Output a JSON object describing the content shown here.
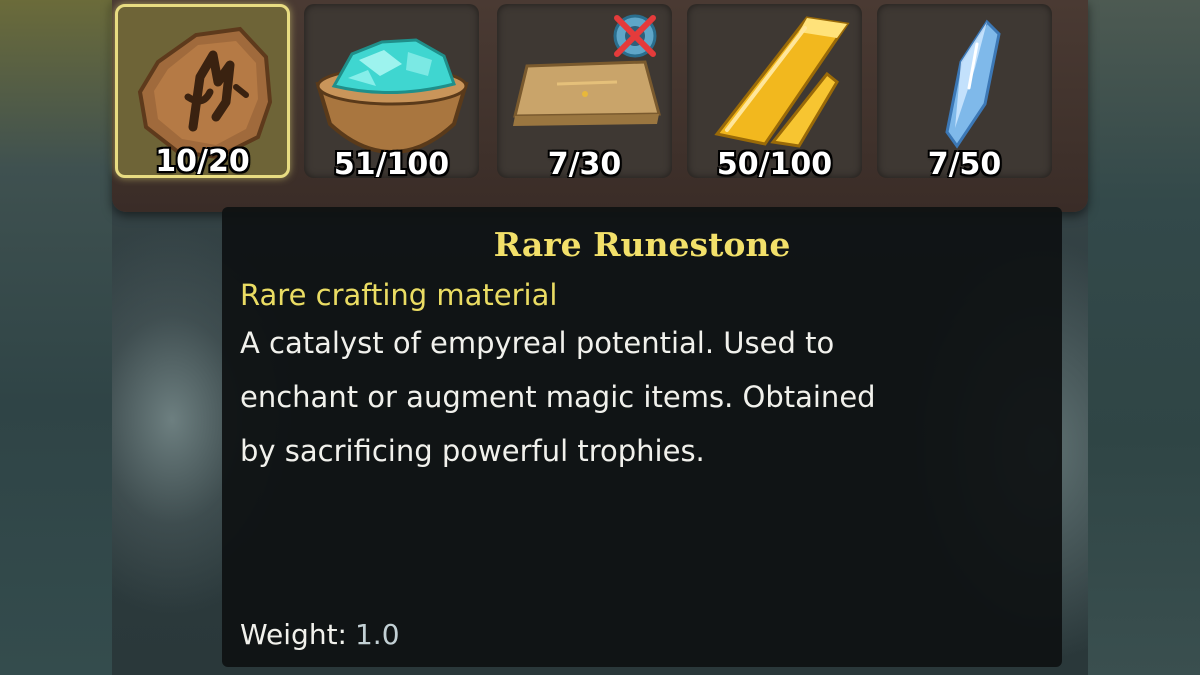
{
  "inventory": {
    "selected_index": 0,
    "slots": [
      {
        "item": "Rare Runestone",
        "icon": "runestone-icon",
        "count": "10/20"
      },
      {
        "item": "crystal bowl",
        "icon": "crystal-bowl-icon",
        "count": "51/100"
      },
      {
        "item": "wooden plank",
        "icon": "plank-icon",
        "count": "7/30",
        "badge_icon": "crossed-out-badge-icon"
      },
      {
        "item": "gold ingot",
        "icon": "gold-ingot-icon",
        "count": "50/100"
      },
      {
        "item": "blue crystal",
        "icon": "blue-crystal-icon",
        "count": "7/50"
      }
    ]
  },
  "tooltip": {
    "title": "Rare Runestone",
    "subtitle": "Rare crafting material",
    "description_lines": [
      "A catalyst of empyreal potential. Used to",
      "enchant or augment magic items. Obtained",
      "by sacrificing powerful trophies."
    ],
    "weight_label": "Weight:",
    "weight_value": "1.0"
  },
  "colors": {
    "title": "#f2e06a",
    "subtitle": "#eadc63",
    "selected_border": "#e8dc82",
    "tooltip_bg": "#0e1112"
  }
}
